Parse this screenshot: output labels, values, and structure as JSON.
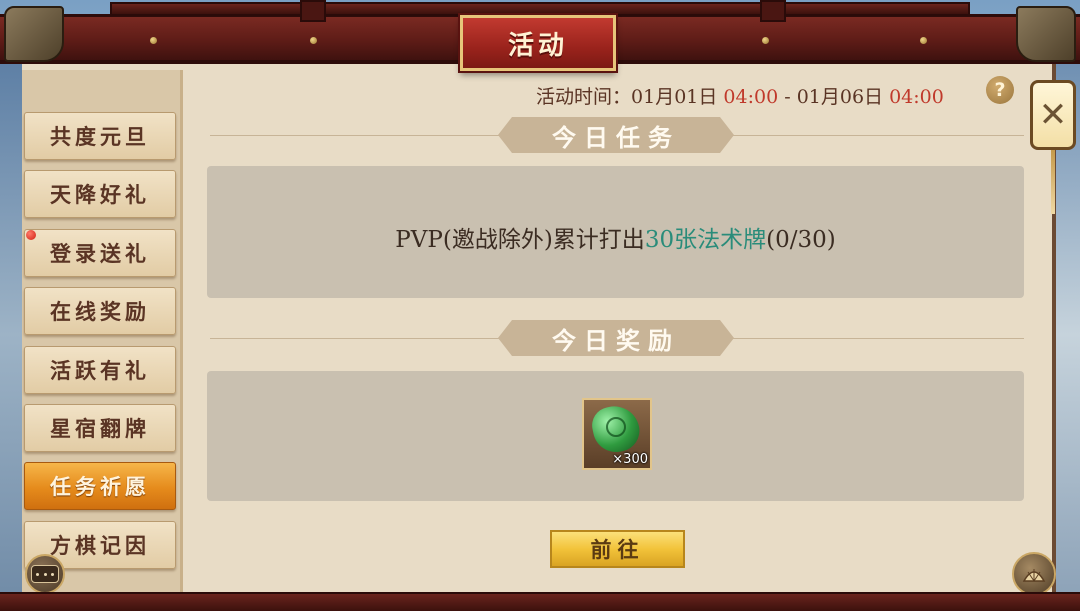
{
  "header": {
    "title": "活动"
  },
  "sidebar": {
    "items": [
      {
        "label": "共度元旦"
      },
      {
        "label": "天降好礼"
      },
      {
        "label": "登录送礼"
      },
      {
        "label": "在线奖励"
      },
      {
        "label": "活跃有礼"
      },
      {
        "label": "星宿翻牌"
      },
      {
        "label": "任务祈愿"
      },
      {
        "label": "方棋记因"
      }
    ],
    "active_index": 6
  },
  "time": {
    "label": "活动时间：",
    "start_date": "01月01日",
    "start_time": "04:00",
    "separator": " - ",
    "end_date": "01月06日",
    "end_time": "04:00"
  },
  "help": {
    "label": "?"
  },
  "task": {
    "header": "今日任务",
    "text_prefix": "PVP(邀战除外)累计打出",
    "text_highlight": "30张法术牌",
    "text_suffix": "(0/30)"
  },
  "reward": {
    "header": "今日奖励",
    "item_icon": "green-jade-icon",
    "quantity": "×300"
  },
  "go_button": {
    "label": "前往"
  },
  "close_button": {
    "label": "✕"
  },
  "colors": {
    "frame": "#5e1c17",
    "highlight": "#2a8c7a",
    "time_red": "#c0392b",
    "active_tab": "#e58b1c"
  }
}
